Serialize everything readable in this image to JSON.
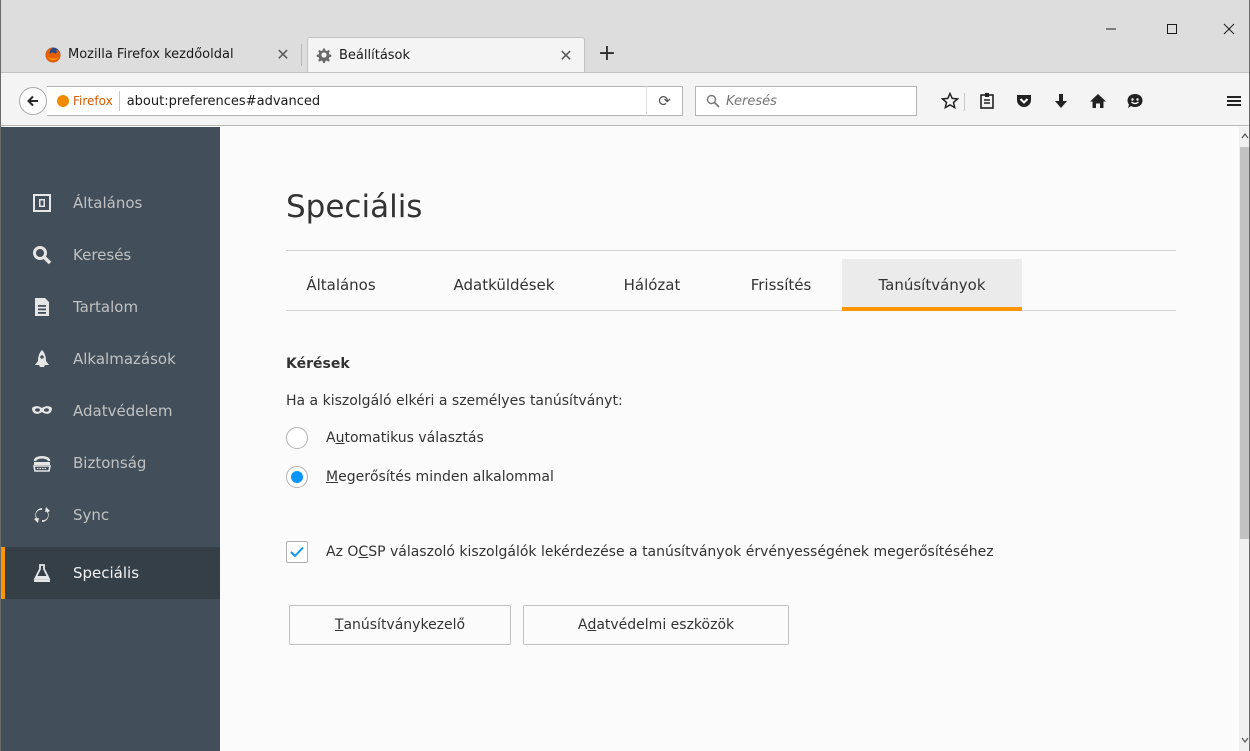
{
  "browser": {
    "tabs": [
      {
        "title": "Mozilla Firefox kezdőoldal",
        "icon": "firefox-logo-icon",
        "active": false
      },
      {
        "title": "Beállítások",
        "icon": "gear-icon",
        "active": true
      }
    ],
    "close_glyph": "✕",
    "new_tab_glyph": "+",
    "window_controls": {
      "minimize": "—",
      "maximize": "☐",
      "close": "✕"
    }
  },
  "navbar": {
    "identity_label": "Firefox",
    "url": "about:preferences#advanced",
    "reload_glyph": "⟳",
    "search_placeholder": "Keresés",
    "toolbar_icons": [
      "star-icon",
      "reading-list-icon",
      "pocket-icon",
      "download-icon",
      "home-icon",
      "hello-icon",
      "menu-icon"
    ]
  },
  "sidebar": {
    "items": [
      {
        "label": "Általános",
        "icon": "general-icon"
      },
      {
        "label": "Keresés",
        "icon": "search-icon"
      },
      {
        "label": "Tartalom",
        "icon": "content-icon"
      },
      {
        "label": "Alkalmazások",
        "icon": "applications-icon"
      },
      {
        "label": "Adatvédelem",
        "icon": "privacy-mask-icon"
      },
      {
        "label": "Biztonság",
        "icon": "security-icon"
      },
      {
        "label": "Sync",
        "icon": "sync-icon"
      },
      {
        "label": "Speciális",
        "icon": "advanced-icon",
        "selected": true
      }
    ]
  },
  "main": {
    "title": "Speciális",
    "tabs": [
      "Általános",
      "Adatküldések",
      "Hálózat",
      "Frissítés",
      "Tanúsítványok"
    ],
    "active_tab": "Tanúsítványok",
    "group_title": "Kérések",
    "description": "Ha a kiszolgáló elkéri a személyes tanúsítványt:",
    "radio_auto": {
      "pre": "A",
      "accel": "u",
      "post": "tomatikus választás",
      "checked": false
    },
    "radio_confirm": {
      "pre": "",
      "accel": "M",
      "post": "egerősítés minden alkalommal",
      "checked": true
    },
    "ocsp_check": {
      "pre": "Az O",
      "accel": "C",
      "post": "SP válaszoló kiszolgálók lekérdezése a tanúsítványok érvényességének megerősítéséhez",
      "checked": true
    },
    "btn_cert_manager": {
      "pre": "",
      "accel": "T",
      "post": "anúsítványkezelő"
    },
    "btn_security_devices": {
      "pre": "A",
      "accel": "d",
      "post": "atvédelmi eszközök"
    }
  },
  "colors": {
    "accent": "#ff9500",
    "sidebar_bg": "#424f5a",
    "sidebar_selected_bg": "#343f48",
    "radio_checked": "#0996f8",
    "checkmark": "#0996f8"
  }
}
